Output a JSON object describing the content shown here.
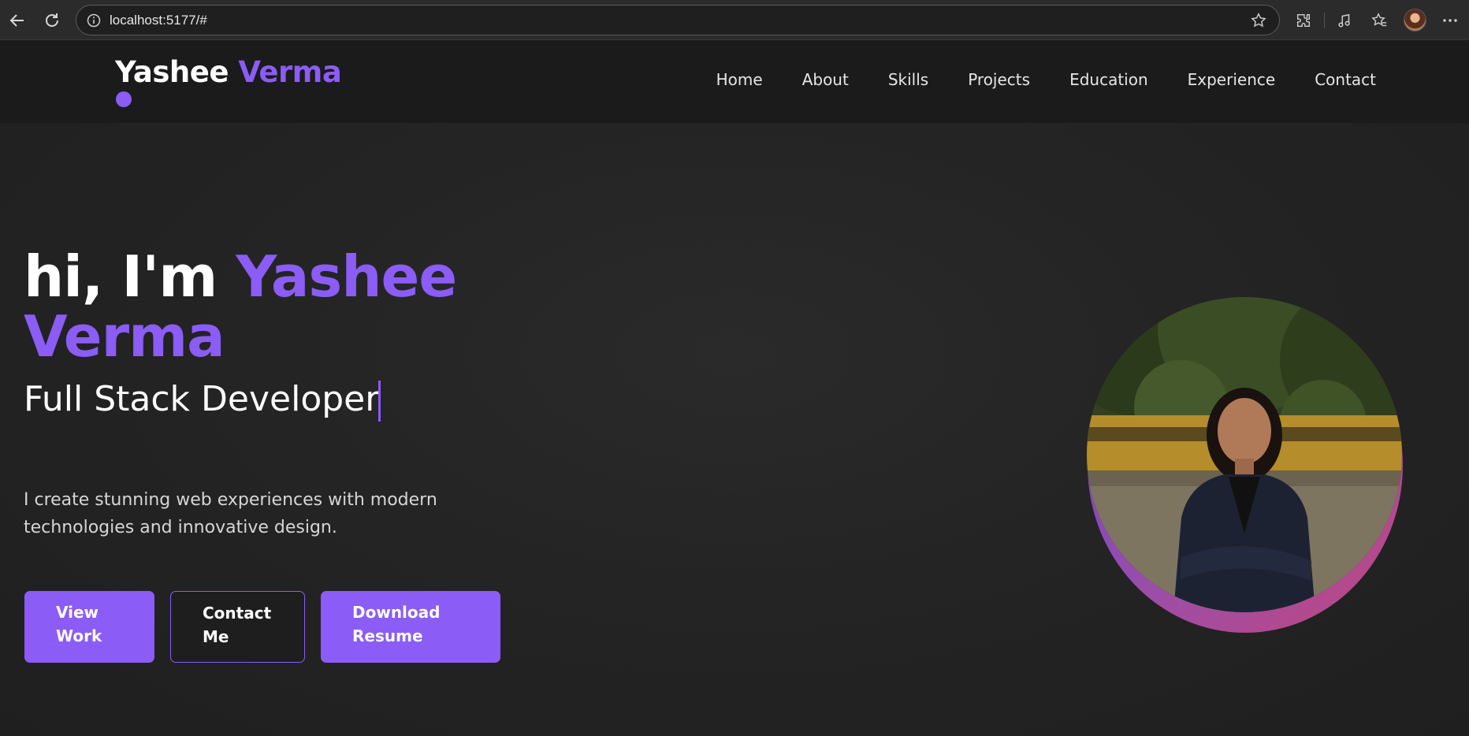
{
  "browser": {
    "url": "localhost:5177/#"
  },
  "header": {
    "logo_first": "Yashee",
    "logo_last": "Verma",
    "nav": [
      {
        "label": "Home"
      },
      {
        "label": "About"
      },
      {
        "label": "Skills"
      },
      {
        "label": "Projects"
      },
      {
        "label": "Education"
      },
      {
        "label": "Experience"
      },
      {
        "label": "Contact"
      }
    ]
  },
  "hero": {
    "greeting": "hi, I'm",
    "name_first": "Yashee",
    "name_last": "Verma",
    "role": "Full Stack Developer",
    "description": "I create stunning web experiences with modern technologies and innovative design.",
    "buttons": {
      "view_work_1": "View",
      "view_work_2": "Work",
      "contact_1": "Contact",
      "contact_2": "Me",
      "resume_1": "Download",
      "resume_2": "Resume"
    }
  },
  "colors": {
    "accent": "#8b5cf6",
    "background": "#202020",
    "header_bg": "#1b1b1b"
  },
  "icons": [
    "back-arrow-icon",
    "reload-icon",
    "info-icon",
    "star-icon",
    "extensions-icon",
    "media-icon",
    "favorites-icon",
    "profile-avatar",
    "more-icon"
  ]
}
